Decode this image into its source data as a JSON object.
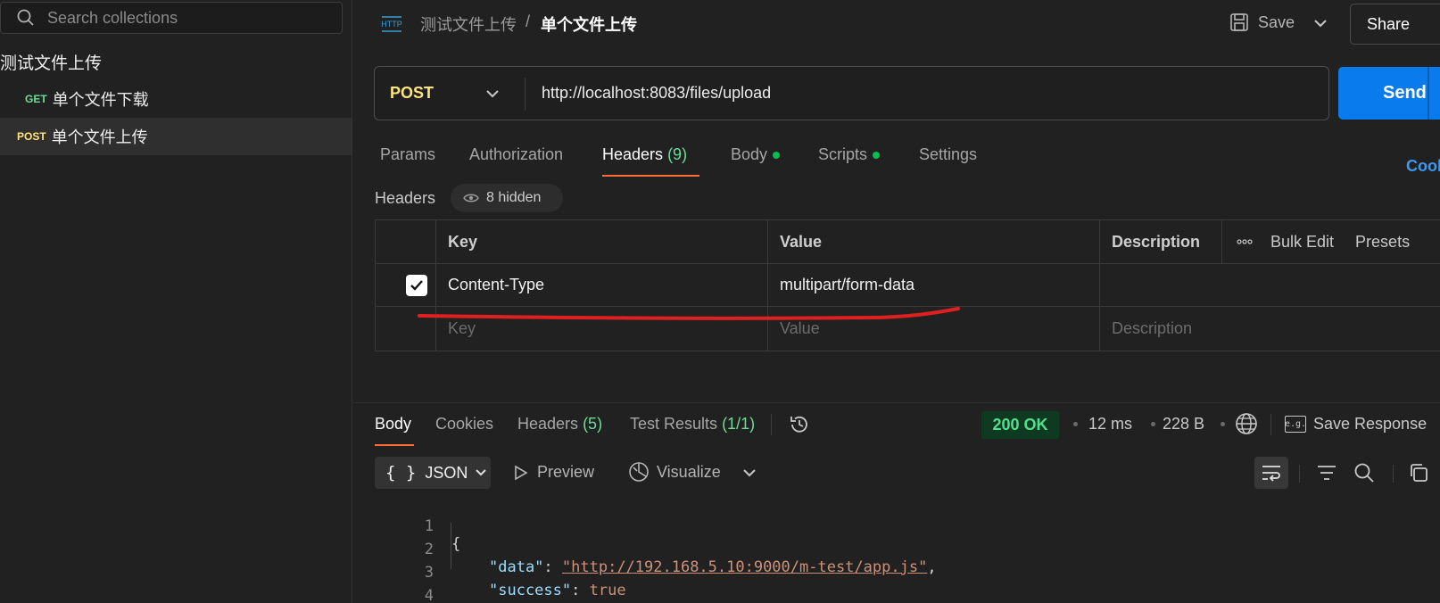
{
  "sidebar": {
    "search_placeholder": "Search collections",
    "collection_name": "测试文件上传",
    "items": [
      {
        "method": "GET",
        "name": "单个文件下载"
      },
      {
        "method": "POST",
        "name": "单个文件上传"
      }
    ]
  },
  "topbar": {
    "breadcrumb_parent": "测试文件上传",
    "breadcrumb_separator": "/",
    "breadcrumb_current": "单个文件上传",
    "save_label": "Save",
    "share_label": "Share"
  },
  "request": {
    "method": "POST",
    "url": "http://localhost:8083/files/upload",
    "send_label": "Send"
  },
  "tabs": {
    "params": "Params",
    "authorization": "Authorization",
    "headers": "Headers",
    "headers_count": "(9)",
    "body": "Body",
    "scripts": "Scripts",
    "settings": "Settings",
    "cookies": "Cook"
  },
  "headers_section": {
    "label": "Headers",
    "hidden_label": "8 hidden",
    "columns": {
      "key": "Key",
      "value": "Value",
      "description": "Description"
    },
    "bulk_edit": "Bulk Edit",
    "presets": "Presets",
    "rows": [
      {
        "checked": true,
        "key": "Content-Type",
        "value": "multipart/form-data"
      }
    ],
    "placeholders": {
      "key": "Key",
      "value": "Value",
      "description": "Description"
    }
  },
  "response": {
    "tabs": {
      "body": "Body",
      "cookies": "Cookies",
      "headers": "Headers",
      "headers_count": "(5)",
      "test_results": "Test Results",
      "test_results_count": "(1/1)"
    },
    "status": "200 OK",
    "time": "12 ms",
    "size": "228 B",
    "save_response": "Save Response",
    "eg_label": "e.g.",
    "format": "JSON",
    "preview": "Preview",
    "visualize": "Visualize",
    "code_lines": [
      {
        "n": "1",
        "open": "{"
      },
      {
        "n": "2",
        "key": "\"data\"",
        "sep": ": ",
        "value": "\"http://192.168.5.10:9000/m-test/app.js\"",
        "tail": ","
      },
      {
        "n": "3",
        "key": "\"success\"",
        "sep": ": ",
        "value": "true"
      },
      {
        "n": "4",
        "close": "}"
      }
    ]
  },
  "colors": {
    "accent_orange": "#ff6c37",
    "send_blue": "#097bed",
    "get_green": "#6bdd9a",
    "post_yellow": "#ffe47e",
    "status_green": "#4ee08a",
    "annotation_red": "#e02020"
  }
}
